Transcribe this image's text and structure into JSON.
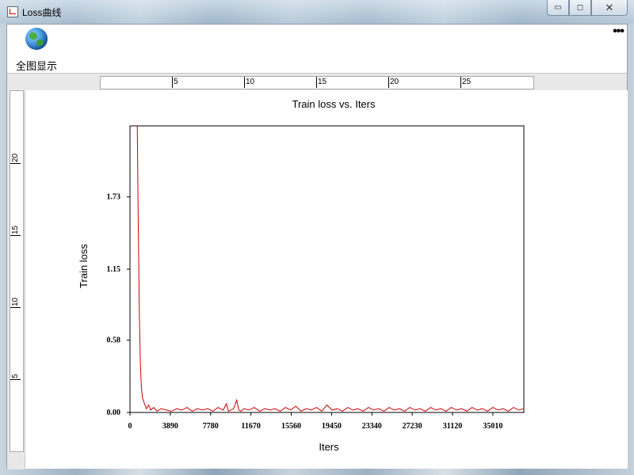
{
  "window": {
    "title": "Loss曲线",
    "controls": {
      "minimize": "▭",
      "restore": "◻",
      "close": "✕"
    }
  },
  "toolbar": {
    "full_view_label": "全图显示",
    "full_view_icon": "globe-icon",
    "more_icon": "•••"
  },
  "rulers": {
    "horizontal_ticks": [
      "5",
      "10",
      "15",
      "20",
      "25"
    ],
    "vertical_ticks": [
      "20",
      "15",
      "10",
      "5"
    ]
  },
  "chart_data": {
    "type": "line",
    "title": "Train loss vs. Iters",
    "xlabel": "Iters",
    "ylabel": "Train loss",
    "x_ticks": [
      0,
      3890,
      7780,
      11670,
      15560,
      19450,
      23340,
      27230,
      31120,
      35010
    ],
    "y_ticks": [
      "0.00",
      "0.58",
      "1.15",
      "1.73"
    ],
    "xlim": [
      0,
      38000
    ],
    "ylim": [
      0,
      2.3
    ],
    "grid": false,
    "series": [
      {
        "color": "#cc0000",
        "points": [
          [
            700,
            2.3
          ],
          [
            800,
            1.5
          ],
          [
            900,
            0.8
          ],
          [
            1000,
            0.4
          ],
          [
            1100,
            0.2
          ],
          [
            1200,
            0.12
          ],
          [
            1400,
            0.07
          ],
          [
            1600,
            0.03
          ],
          [
            1800,
            0.06
          ],
          [
            2000,
            0.02
          ],
          [
            2300,
            0.04
          ],
          [
            2600,
            0.01
          ],
          [
            3000,
            0.03
          ],
          [
            3500,
            0.02
          ],
          [
            4000,
            0.01
          ],
          [
            4500,
            0.03
          ],
          [
            5000,
            0.02
          ],
          [
            5500,
            0.04
          ],
          [
            6000,
            0.01
          ],
          [
            6500,
            0.03
          ],
          [
            7000,
            0.02
          ],
          [
            7500,
            0.03
          ],
          [
            8000,
            0.01
          ],
          [
            8500,
            0.04
          ],
          [
            9000,
            0.02
          ],
          [
            9300,
            0.07
          ],
          [
            9500,
            0.01
          ],
          [
            10000,
            0.03
          ],
          [
            10500,
            0.02
          ],
          [
            10300,
            0.1
          ],
          [
            10700,
            0.01
          ],
          [
            11000,
            0.03
          ],
          [
            11500,
            0.02
          ],
          [
            12000,
            0.04
          ],
          [
            12500,
            0.01
          ],
          [
            13000,
            0.03
          ],
          [
            13500,
            0.02
          ],
          [
            14000,
            0.03
          ],
          [
            14500,
            0.01
          ],
          [
            15000,
            0.04
          ],
          [
            15500,
            0.02
          ],
          [
            16000,
            0.05
          ],
          [
            16500,
            0.01
          ],
          [
            17000,
            0.03
          ],
          [
            17500,
            0.02
          ],
          [
            18000,
            0.04
          ],
          [
            18500,
            0.01
          ],
          [
            19000,
            0.06
          ],
          [
            19500,
            0.02
          ],
          [
            20000,
            0.03
          ],
          [
            20500,
            0.01
          ],
          [
            21000,
            0.04
          ],
          [
            21500,
            0.02
          ],
          [
            22000,
            0.03
          ],
          [
            22500,
            0.01
          ],
          [
            23000,
            0.04
          ],
          [
            23500,
            0.02
          ],
          [
            24000,
            0.03
          ],
          [
            24500,
            0.01
          ],
          [
            25000,
            0.04
          ],
          [
            25500,
            0.02
          ],
          [
            26000,
            0.03
          ],
          [
            26500,
            0.01
          ],
          [
            27000,
            0.04
          ],
          [
            27500,
            0.02
          ],
          [
            28000,
            0.03
          ],
          [
            28500,
            0.01
          ],
          [
            29000,
            0.04
          ],
          [
            29500,
            0.02
          ],
          [
            30000,
            0.03
          ],
          [
            30500,
            0.01
          ],
          [
            31000,
            0.04
          ],
          [
            31500,
            0.02
          ],
          [
            32000,
            0.03
          ],
          [
            32500,
            0.01
          ],
          [
            33000,
            0.04
          ],
          [
            33500,
            0.02
          ],
          [
            34000,
            0.03
          ],
          [
            34500,
            0.01
          ],
          [
            35000,
            0.04
          ],
          [
            35500,
            0.02
          ],
          [
            36000,
            0.03
          ],
          [
            36500,
            0.01
          ],
          [
            37000,
            0.04
          ],
          [
            37500,
            0.02
          ],
          [
            38000,
            0.03
          ]
        ]
      }
    ]
  }
}
